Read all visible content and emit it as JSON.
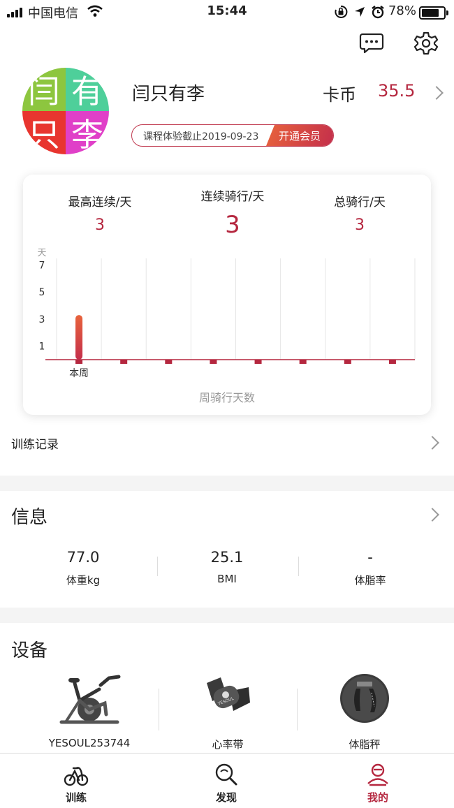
{
  "status_bar": {
    "carrier": "中国电信",
    "time": "15:44",
    "battery": "78%"
  },
  "profile": {
    "avatar_chars": [
      "闫",
      "有",
      "只",
      "李"
    ],
    "name": "闫只有李",
    "coin_label": "卡币",
    "coin_value": "35.5",
    "membership_text": "课程体验截止2019-09-23",
    "membership_button": "开通会员"
  },
  "stats": {
    "max_streak_label": "最高连续/天",
    "max_streak_value": "3",
    "current_streak_label": "连续骑行/天",
    "current_streak_value": "3",
    "total_label": "总骑行/天",
    "total_value": "3"
  },
  "chart_data": {
    "type": "bar",
    "title": "周骑行天数",
    "ylabel": "天",
    "yticks": [
      1,
      3,
      5,
      7
    ],
    "ylim": [
      0,
      8
    ],
    "categories": [
      "本周",
      "",
      "",
      "",
      "",
      "",
      "",
      ""
    ],
    "values": [
      3,
      0,
      0,
      0,
      0,
      0,
      0,
      0
    ],
    "grid": true
  },
  "training_record": {
    "label": "训练记录"
  },
  "info": {
    "title": "信息",
    "items": [
      {
        "value": "77.0",
        "label": "体重kg"
      },
      {
        "value": "25.1",
        "label": "BMI"
      },
      {
        "value": "-",
        "label": "体脂率"
      }
    ]
  },
  "devices": {
    "title": "设备",
    "items": [
      {
        "label": "YESOUL253744",
        "icon": "bike-icon"
      },
      {
        "label": "心率带",
        "icon": "heart-rate-strap-icon",
        "brand": "YESOUL"
      },
      {
        "label": "体脂秤",
        "icon": "body-fat-scale-icon"
      }
    ]
  },
  "tabbar": {
    "items": [
      {
        "label": "训练",
        "icon": "training-icon"
      },
      {
        "label": "发现",
        "icon": "discover-icon"
      },
      {
        "label": "我的",
        "icon": "profile-icon",
        "active": true
      }
    ],
    "active_color": "#b5273f"
  },
  "colors": {
    "accent": "#b5273f",
    "bar_top": "#e8633c",
    "bar_bottom": "#c42f4b"
  }
}
